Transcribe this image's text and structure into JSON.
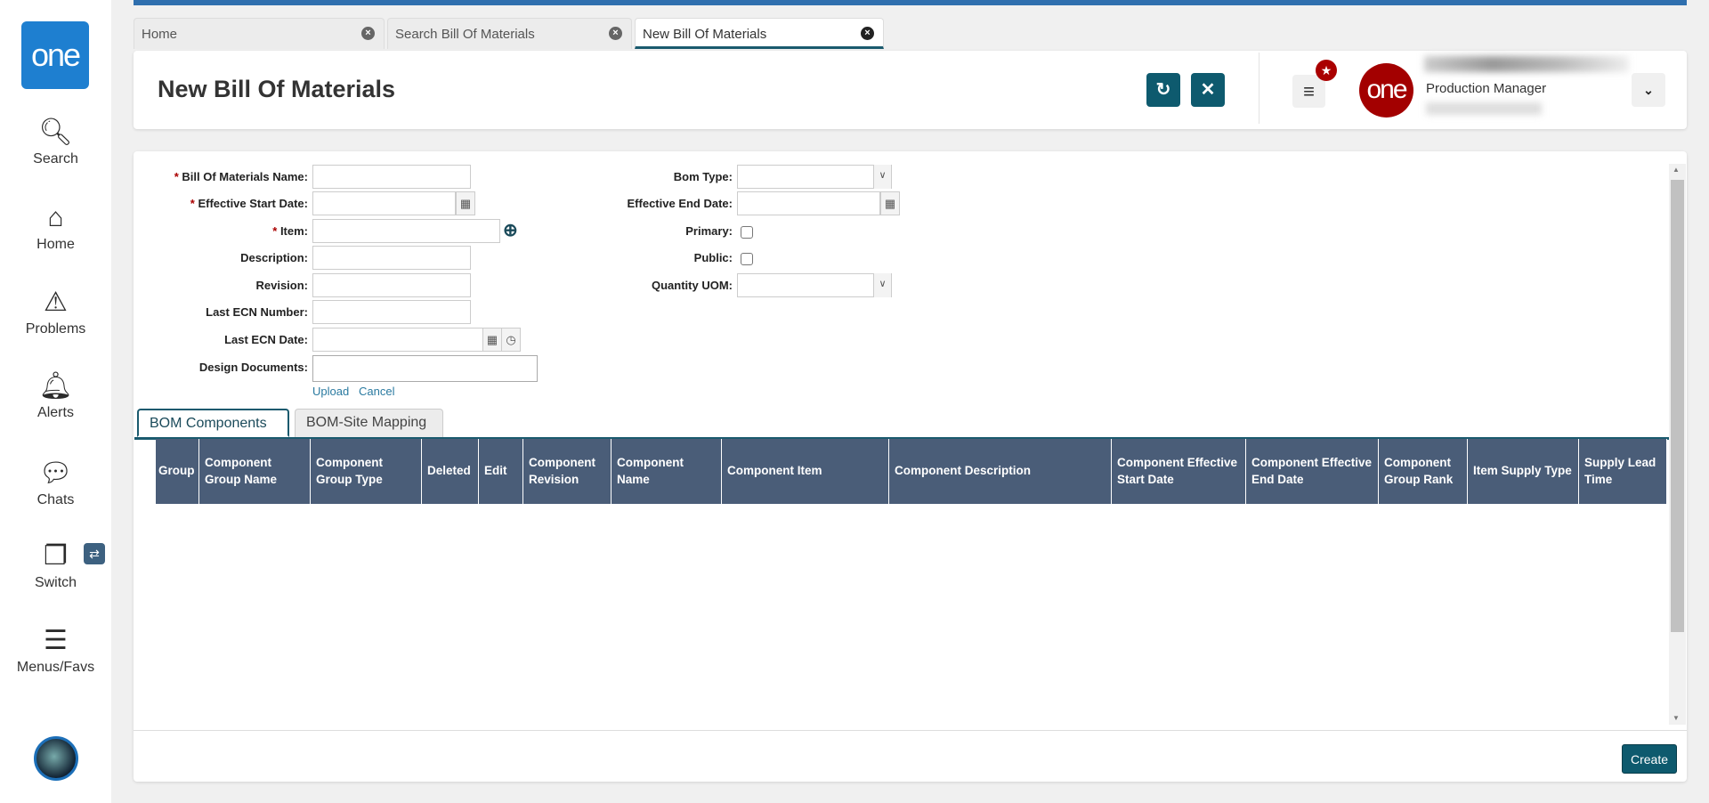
{
  "sidebar": {
    "logo": "one",
    "items": [
      {
        "label": "Search"
      },
      {
        "label": "Home"
      },
      {
        "label": "Problems"
      },
      {
        "label": "Alerts"
      },
      {
        "label": "Chats"
      },
      {
        "label": "Switch"
      },
      {
        "label": "Menus/Favs"
      }
    ]
  },
  "tabs": [
    {
      "label": "Home"
    },
    {
      "label": "Search Bill Of Materials"
    },
    {
      "label": "New Bill Of Materials"
    }
  ],
  "header": {
    "title": "New Bill Of Materials",
    "role": "Production Manager",
    "avatar_text": "one"
  },
  "form": {
    "left": [
      {
        "label": "Bill Of Materials Name:",
        "required": true
      },
      {
        "label": "Effective Start Date:",
        "required": true
      },
      {
        "label": "Item:",
        "required": true
      },
      {
        "label": "Description:"
      },
      {
        "label": "Revision:"
      },
      {
        "label": "Last ECN Number:"
      },
      {
        "label": "Last ECN Date:"
      },
      {
        "label": "Design Documents:"
      }
    ],
    "right": [
      {
        "label": "Bom Type:"
      },
      {
        "label": "Effective End Date:"
      },
      {
        "label": "Primary:"
      },
      {
        "label": "Public:"
      },
      {
        "label": "Quantity UOM:"
      }
    ],
    "upload": "Upload",
    "cancel": "Cancel"
  },
  "subtabs": [
    {
      "label": "BOM Components"
    },
    {
      "label": "BOM-Site Mapping"
    }
  ],
  "table": {
    "columns": [
      "Group",
      "Component Group Name",
      "Component Group Type",
      "Deleted",
      "Edit",
      "Component Revision",
      "Component Name",
      "Component Item",
      "Component Description",
      "Component Effective Start Date",
      "Component Effective End Date",
      "Component Group Rank",
      "Item Supply Type",
      "Supply Lead Time"
    ]
  },
  "footer": {
    "create": "Create"
  },
  "colors": {
    "accent": "#0e5a6e",
    "table_header": "#4a5d78",
    "brand_blue": "#1e7fd0",
    "brand_red": "#a30000"
  }
}
